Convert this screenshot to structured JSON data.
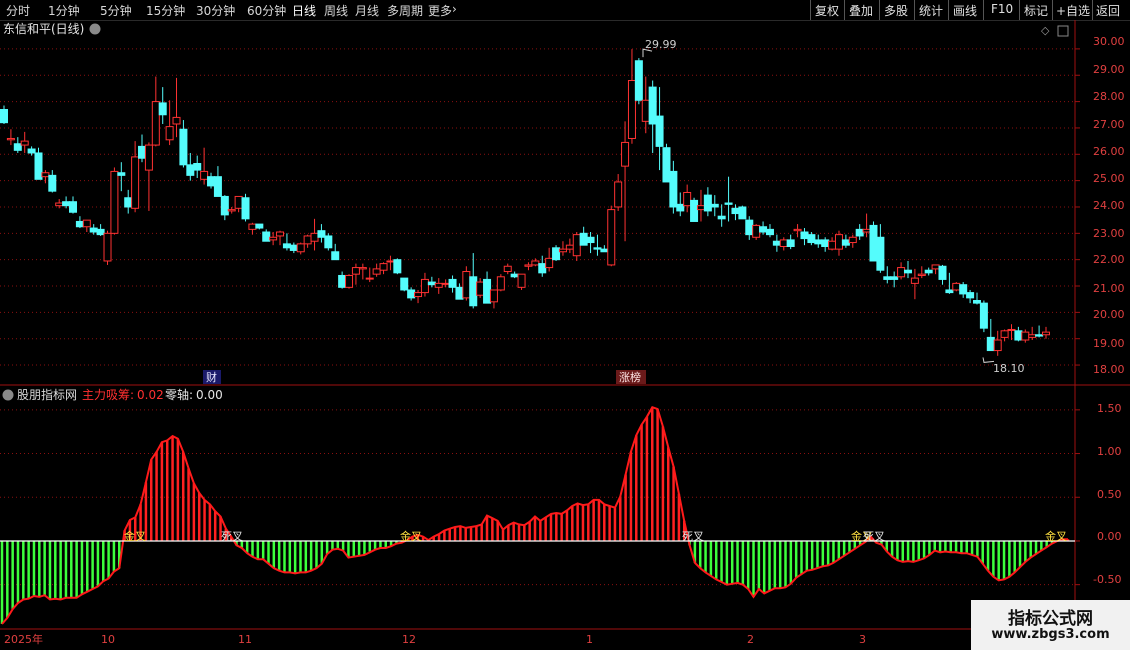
{
  "toolbar": {
    "periods": [
      "分时",
      "1分钟",
      "5分钟",
      "15分钟",
      "30分钟",
      "60分钟",
      "日线",
      "周线",
      "月线",
      "多周期",
      "更多"
    ],
    "active_period": "日线",
    "actions": [
      "复权",
      "叠加",
      "多股",
      "统计",
      "画线",
      "F10",
      "标记",
      "+自选",
      "返回"
    ]
  },
  "main_panel": {
    "title": "东信和平(日线)",
    "high_label": "29.99",
    "low_label": "18.10",
    "markers": [
      "财",
      "涨榜"
    ],
    "y_ticks": [
      "30.00",
      "29.00",
      "28.00",
      "27.00",
      "26.00",
      "25.00",
      "24.00",
      "23.00",
      "22.00",
      "21.00",
      "20.00",
      "19.00",
      "18.00"
    ]
  },
  "sub_panel": {
    "site_label": "股朋指标网",
    "series1_label": "主力吸筹:",
    "series1_value": "0.02",
    "series2_label": "零轴:",
    "series2_value": "0.00",
    "y_ticks": [
      "1.50",
      "1.00",
      "0.50",
      "0.00",
      "-0.50"
    ],
    "signals": [
      "金叉",
      "死叉",
      "金叉",
      "死叉",
      "金叉",
      "死叉",
      "金叉"
    ]
  },
  "time_axis": [
    "2025年",
    "10",
    "11",
    "12",
    "1",
    "2",
    "3"
  ],
  "watermark": {
    "line1": "指标公式网",
    "line2": "www.zbgs3.com"
  },
  "colors": {
    "up": "#ff3232",
    "down": "#54fcfc",
    "pos": "#ff2020",
    "neg": "#3cff3c",
    "border": "#a01010",
    "grid": "#8a1010"
  },
  "chart_data": {
    "type": "candlestick",
    "y_range": [
      17.85,
      30.3
    ],
    "ohlc": [
      [
        27.7,
        27.85,
        27.15,
        27.2
      ],
      [
        26.55,
        26.95,
        26.35,
        26.6
      ],
      [
        26.4,
        26.65,
        26.05,
        26.15
      ],
      [
        26.35,
        26.85,
        26.05,
        26.5
      ],
      [
        26.2,
        26.3,
        25.95,
        26.05
      ],
      [
        26.05,
        26.25,
        25.05,
        25.05
      ],
      [
        25.15,
        25.4,
        24.9,
        25.3
      ],
      [
        25.2,
        25.4,
        24.55,
        24.6
      ],
      [
        24.05,
        24.3,
        23.95,
        24.15
      ],
      [
        24.2,
        24.4,
        23.95,
        24.05
      ],
      [
        24.2,
        24.4,
        23.75,
        23.8
      ],
      [
        23.45,
        23.65,
        23.2,
        23.25
      ],
      [
        23.25,
        23.5,
        23.05,
        23.5
      ],
      [
        23.2,
        23.35,
        22.95,
        23.05
      ],
      [
        23.15,
        23.35,
        22.9,
        22.95
      ],
      [
        21.95,
        23.1,
        21.8,
        23.0
      ],
      [
        23.0,
        25.5,
        22.95,
        25.35
      ],
      [
        25.3,
        25.7,
        24.6,
        25.2
      ],
      [
        24.35,
        24.65,
        23.75,
        24.0
      ],
      [
        23.95,
        26.5,
        23.8,
        25.9
      ],
      [
        26.3,
        26.75,
        25.7,
        25.85
      ],
      [
        25.4,
        26.45,
        23.85,
        26.35
      ],
      [
        26.35,
        28.95,
        26.3,
        28.0
      ],
      [
        27.95,
        28.55,
        27.15,
        27.5
      ],
      [
        26.55,
        28.05,
        26.35,
        27.05
      ],
      [
        27.15,
        28.9,
        26.65,
        27.4
      ],
      [
        26.95,
        27.3,
        25.5,
        25.6
      ],
      [
        25.6,
        26.05,
        25.0,
        25.2
      ],
      [
        25.65,
        25.95,
        25.1,
        25.4
      ],
      [
        25.05,
        26.25,
        24.85,
        25.35
      ],
      [
        25.15,
        25.3,
        24.7,
        24.8
      ],
      [
        25.15,
        25.55,
        24.4,
        24.4
      ],
      [
        24.4,
        24.45,
        23.5,
        23.7
      ],
      [
        23.85,
        24.0,
        23.75,
        23.9
      ],
      [
        23.95,
        24.35,
        23.8,
        24.4
      ],
      [
        24.35,
        24.5,
        23.45,
        23.55
      ],
      [
        23.15,
        23.4,
        22.95,
        23.35
      ],
      [
        23.35,
        23.35,
        23.15,
        23.2
      ],
      [
        23.05,
        23.15,
        22.75,
        22.7
      ],
      [
        22.75,
        23.05,
        22.55,
        22.85
      ],
      [
        22.9,
        23.1,
        22.55,
        23.05
      ],
      [
        22.6,
        23.0,
        22.35,
        22.45
      ],
      [
        22.55,
        22.65,
        22.25,
        22.35
      ],
      [
        22.3,
        22.65,
        22.2,
        22.6
      ],
      [
        22.6,
        22.95,
        22.45,
        22.9
      ],
      [
        22.7,
        23.55,
        22.35,
        23.0
      ],
      [
        23.1,
        23.35,
        22.65,
        22.85
      ],
      [
        22.9,
        23.0,
        22.35,
        22.45
      ],
      [
        22.3,
        22.6,
        22.1,
        22.0
      ],
      [
        21.4,
        21.55,
        20.9,
        20.95
      ],
      [
        20.95,
        21.45,
        20.9,
        21.4
      ],
      [
        21.45,
        21.85,
        21.05,
        21.7
      ],
      [
        21.65,
        21.85,
        21.25,
        21.7
      ],
      [
        21.3,
        21.7,
        21.15,
        21.3
      ],
      [
        21.45,
        21.85,
        21.35,
        21.65
      ],
      [
        21.6,
        21.9,
        21.45,
        21.85
      ],
      [
        21.95,
        22.15,
        21.6,
        21.95
      ],
      [
        22.0,
        22.05,
        21.45,
        21.5
      ],
      [
        21.3,
        21.3,
        20.8,
        20.85
      ],
      [
        20.85,
        20.95,
        20.45,
        20.55
      ],
      [
        20.6,
        20.85,
        20.35,
        20.75
      ],
      [
        20.75,
        21.5,
        20.6,
        21.25
      ],
      [
        21.15,
        21.35,
        20.95,
        21.05
      ],
      [
        20.95,
        21.3,
        20.7,
        21.1
      ],
      [
        21.1,
        21.25,
        20.95,
        21.1
      ],
      [
        21.25,
        21.4,
        20.75,
        20.95
      ],
      [
        20.95,
        21.1,
        20.5,
        20.5
      ],
      [
        20.55,
        21.75,
        20.45,
        21.55
      ],
      [
        21.35,
        22.25,
        20.15,
        20.25
      ],
      [
        20.65,
        21.3,
        20.55,
        21.15
      ],
      [
        21.25,
        21.55,
        20.45,
        20.35
      ],
      [
        20.4,
        20.85,
        20.15,
        20.85
      ],
      [
        20.85,
        21.45,
        20.8,
        21.35
      ],
      [
        21.55,
        21.85,
        21.45,
        21.75
      ],
      [
        21.45,
        21.55,
        21.3,
        21.35
      ],
      [
        20.95,
        21.45,
        20.85,
        21.45
      ],
      [
        21.75,
        21.9,
        21.6,
        21.8
      ],
      [
        21.8,
        22.05,
        21.75,
        21.95
      ],
      [
        21.85,
        22.15,
        21.35,
        21.5
      ],
      [
        21.7,
        22.45,
        21.55,
        22.05
      ],
      [
        22.45,
        22.55,
        21.95,
        22.0
      ],
      [
        22.3,
        22.7,
        22.15,
        22.4
      ],
      [
        22.4,
        22.8,
        22.25,
        22.55
      ],
      [
        22.15,
        23.05,
        21.95,
        22.95
      ],
      [
        23.0,
        23.25,
        22.55,
        22.55
      ],
      [
        22.85,
        23.05,
        22.25,
        22.65
      ],
      [
        22.45,
        22.95,
        22.15,
        22.4
      ],
      [
        22.4,
        22.55,
        22.3,
        22.3
      ],
      [
        21.8,
        24.05,
        21.75,
        23.9
      ],
      [
        24.0,
        25.25,
        23.85,
        24.95
      ],
      [
        25.55,
        27.25,
        22.7,
        26.45
      ],
      [
        26.6,
        29.99,
        26.4,
        28.8
      ],
      [
        29.55,
        29.65,
        27.9,
        28.05
      ],
      [
        27.25,
        28.95,
        26.8,
        28.05
      ],
      [
        28.55,
        28.8,
        26.05,
        27.15
      ],
      [
        27.45,
        28.55,
        25.4,
        26.3
      ],
      [
        26.25,
        26.4,
        24.95,
        24.95
      ],
      [
        25.35,
        25.75,
        23.75,
        24.0
      ],
      [
        24.1,
        24.55,
        23.65,
        23.85
      ],
      [
        24.05,
        24.85,
        23.8,
        24.55
      ],
      [
        24.25,
        24.35,
        23.45,
        23.45
      ],
      [
        23.9,
        24.65,
        23.45,
        24.05
      ],
      [
        24.45,
        24.75,
        23.65,
        23.85
      ],
      [
        24.1,
        24.45,
        23.65,
        24.0
      ],
      [
        23.65,
        24.1,
        23.25,
        23.55
      ],
      [
        24.15,
        25.15,
        23.45,
        24.1
      ],
      [
        23.95,
        24.1,
        23.5,
        23.75
      ],
      [
        24.0,
        24.05,
        23.65,
        23.55
      ],
      [
        23.5,
        23.65,
        22.75,
        22.95
      ],
      [
        22.85,
        23.35,
        22.75,
        23.3
      ],
      [
        23.25,
        23.45,
        22.95,
        23.05
      ],
      [
        23.15,
        23.35,
        22.85,
        22.95
      ],
      [
        22.7,
        22.95,
        22.3,
        22.55
      ],
      [
        22.5,
        22.85,
        22.35,
        22.75
      ],
      [
        22.75,
        22.95,
        22.4,
        22.5
      ],
      [
        23.1,
        23.35,
        22.85,
        23.15
      ],
      [
        23.05,
        23.2,
        22.55,
        22.8
      ],
      [
        22.95,
        23.05,
        22.55,
        22.65
      ],
      [
        22.75,
        22.95,
        22.45,
        22.6
      ],
      [
        22.75,
        22.85,
        22.3,
        22.5
      ],
      [
        22.4,
        22.85,
        22.35,
        22.7
      ],
      [
        22.4,
        23.1,
        22.15,
        22.95
      ],
      [
        22.75,
        22.95,
        22.45,
        22.55
      ],
      [
        22.65,
        22.95,
        22.45,
        22.85
      ],
      [
        23.15,
        23.35,
        22.75,
        22.9
      ],
      [
        23.05,
        23.75,
        22.85,
        23.15
      ],
      [
        23.3,
        23.45,
        21.95,
        21.95
      ],
      [
        22.85,
        23.35,
        21.5,
        21.6
      ],
      [
        21.35,
        21.75,
        21.1,
        21.25
      ],
      [
        21.35,
        21.55,
        20.95,
        21.25
      ],
      [
        21.35,
        21.9,
        21.25,
        21.7
      ],
      [
        21.6,
        21.95,
        21.3,
        21.5
      ],
      [
        21.1,
        21.65,
        20.5,
        21.3
      ],
      [
        21.4,
        21.75,
        21.3,
        21.45
      ],
      [
        21.6,
        21.7,
        21.4,
        21.5
      ],
      [
        21.65,
        21.8,
        21.45,
        21.8
      ],
      [
        21.75,
        21.8,
        21.05,
        21.25
      ],
      [
        20.85,
        21.5,
        20.7,
        20.75
      ],
      [
        20.85,
        21.15,
        20.8,
        21.1
      ],
      [
        21.05,
        21.15,
        20.55,
        20.7
      ],
      [
        20.75,
        20.85,
        20.35,
        20.55
      ],
      [
        20.45,
        20.75,
        20.3,
        20.35
      ],
      [
        20.35,
        20.45,
        19.25,
        19.4
      ],
      [
        19.05,
        19.75,
        18.8,
        18.55
      ],
      [
        18.55,
        19.3,
        18.35,
        18.95
      ],
      [
        19.05,
        19.35,
        18.9,
        19.3
      ],
      [
        19.35,
        19.55,
        18.95,
        19.35
      ],
      [
        19.3,
        19.45,
        18.9,
        18.95
      ],
      [
        18.95,
        19.35,
        18.85,
        19.25
      ],
      [
        19.05,
        19.45,
        18.95,
        19.15
      ],
      [
        19.15,
        19.5,
        19.05,
        19.1
      ],
      [
        19.15,
        19.45,
        19.0,
        19.25
      ]
    ],
    "indicator": {
      "name": "主力吸筹",
      "zero_axis": 0.0,
      "y_range": [
        -0.95,
        1.75
      ],
      "values": [
        -0.95,
        -0.88,
        -0.78,
        -0.71,
        -0.67,
        -0.66,
        -0.63,
        -0.64,
        -0.62,
        -0.67,
        -0.66,
        -0.67,
        -0.65,
        -0.65,
        -0.65,
        -0.61,
        -0.58,
        -0.55,
        -0.52,
        -0.46,
        -0.43,
        -0.35,
        -0.31,
        0.12,
        0.24,
        0.27,
        0.42,
        0.67,
        0.93,
        1.02,
        1.13,
        1.15,
        1.2,
        1.17,
        1.02,
        0.83,
        0.66,
        0.55,
        0.47,
        0.42,
        0.34,
        0.28,
        0.14,
        0.05,
        -0.05,
        -0.08,
        -0.14,
        -0.18,
        -0.21,
        -0.21,
        -0.26,
        -0.31,
        -0.34,
        -0.36,
        -0.36,
        -0.37,
        -0.36,
        -0.36,
        -0.34,
        -0.31,
        -0.26,
        -0.15,
        -0.1,
        -0.09,
        -0.11,
        -0.19,
        -0.18,
        -0.17,
        -0.16,
        -0.13,
        -0.1,
        -0.08,
        -0.08,
        -0.06,
        -0.03,
        -0.02,
        0.01,
        0.05,
        0.07,
        0.05,
        0.01,
        0.05,
        0.08,
        0.12,
        0.14,
        0.16,
        0.17,
        0.15,
        0.16,
        0.17,
        0.19,
        0.29,
        0.26,
        0.23,
        0.13,
        0.18,
        0.21,
        0.19,
        0.18,
        0.22,
        0.28,
        0.23,
        0.27,
        0.31,
        0.32,
        0.31,
        0.35,
        0.4,
        0.43,
        0.41,
        0.42,
        0.47,
        0.47,
        0.42,
        0.4,
        0.38,
        0.51,
        0.76,
        1.02,
        1.21,
        1.33,
        1.42,
        1.53,
        1.51,
        1.31,
        1.07,
        0.85,
        0.54,
        0.23,
        -0.05,
        -0.25,
        -0.31,
        -0.36,
        -0.4,
        -0.44,
        -0.47,
        -0.5,
        -0.49,
        -0.48,
        -0.5,
        -0.55,
        -0.64,
        -0.55,
        -0.6,
        -0.57,
        -0.54,
        -0.54,
        -0.53,
        -0.49,
        -0.42,
        -0.38,
        -0.34,
        -0.33,
        -0.31,
        -0.29,
        -0.28,
        -0.25,
        -0.21,
        -0.17,
        -0.13,
        -0.09,
        -0.05,
        -0.01,
        0.05,
        -0.02,
        -0.04,
        -0.12,
        -0.18,
        -0.22,
        -0.24,
        -0.23,
        -0.24,
        -0.22,
        -0.2,
        -0.16,
        -0.11,
        -0.13,
        -0.12,
        -0.13,
        -0.13,
        -0.14,
        -0.14,
        -0.16,
        -0.18,
        -0.26,
        -0.34,
        -0.41,
        -0.45,
        -0.44,
        -0.41,
        -0.36,
        -0.3,
        -0.24,
        -0.19,
        -0.15,
        -0.11,
        -0.07,
        -0.03,
        0.0,
        0.02,
        0.02
      ]
    }
  }
}
